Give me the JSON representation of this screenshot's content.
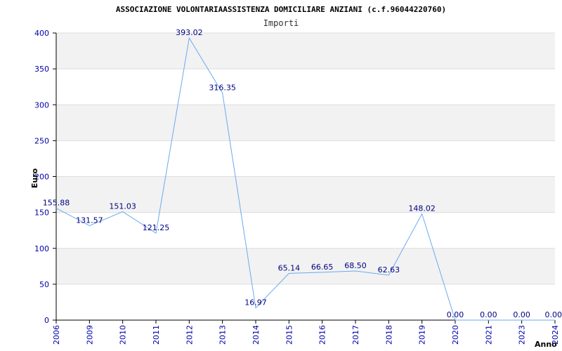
{
  "chart_data": {
    "type": "line",
    "title": "ASSOCIAZIONE VOLONTARIAASSISTENZA DOMICILIARE ANZIANI (c.f.96044220760)",
    "subtitle": "Importi",
    "xlabel": "Anno",
    "ylabel": "Euro",
    "ylim": [
      0,
      400
    ],
    "yticks": [
      "0",
      "50",
      "100",
      "150",
      "200",
      "250",
      "300",
      "350",
      "400"
    ],
    "grid": true,
    "line_color": "#6aaaf0",
    "band_color": "#f2f2f2",
    "tick_color": "#0000aa",
    "label_color": "#000080",
    "categories": [
      "2006",
      "2009",
      "2010",
      "2011",
      "2012",
      "2013",
      "2014",
      "2015",
      "2016",
      "2017",
      "2018",
      "2019",
      "2020",
      "2021",
      "2023",
      "2024"
    ],
    "series": [
      {
        "values": [
          155.88,
          131.57,
          151.03,
          121.25,
          393.02,
          316.35,
          16.97,
          65.14,
          66.65,
          68.5,
          62.63,
          148.02,
          0,
          0,
          0,
          0
        ],
        "labels": [
          "155.88",
          "131.57",
          "151.03",
          "121.25",
          "393.02",
          "316.35",
          "16.97",
          "65.14",
          "66.65",
          "68.50",
          "62.63",
          "148.02",
          "0.00",
          "0.00",
          "0.00",
          "0.00"
        ]
      }
    ]
  }
}
